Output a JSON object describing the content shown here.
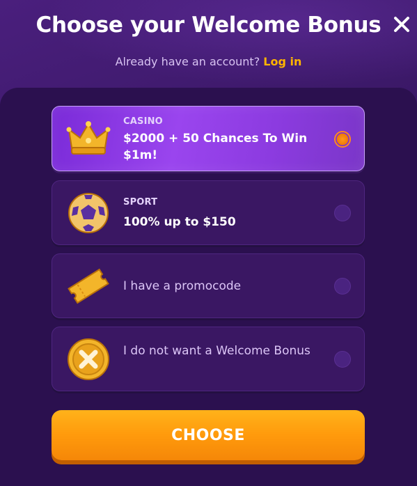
{
  "header": {
    "title": "Choose your Welcome Bonus",
    "subtitle_text": "Already have an account?",
    "login_label": "Log in"
  },
  "options": [
    {
      "category": "CASINO",
      "text": "$2000 + 50 Chances To Win $1m!",
      "selected": true,
      "icon": "crown-icon"
    },
    {
      "category": "SPORT",
      "text": "100% up to $150",
      "selected": false,
      "icon": "soccer-ball-icon"
    },
    {
      "category": "",
      "text": "I have a promocode",
      "selected": false,
      "icon": "ticket-icon"
    },
    {
      "category": "",
      "text": "I do not want a Welcome Bonus",
      "selected": false,
      "icon": "no-coin-icon"
    }
  ],
  "choose_label": "CHOOSE",
  "colors": {
    "accent": "#ff9a0c",
    "login": "#ffb400",
    "selected": "#8c3be0",
    "background": "#2b104f"
  }
}
